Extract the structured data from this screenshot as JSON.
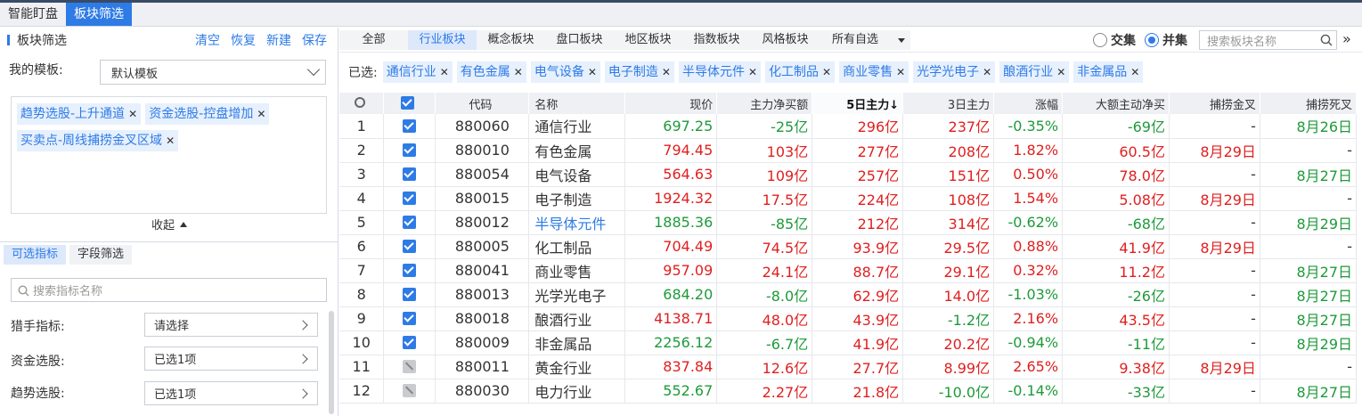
{
  "tabs": [
    "智能盯盘",
    "板块筛选"
  ],
  "left": {
    "title": "板块筛选",
    "actions": [
      "清空",
      "恢复",
      "新建",
      "保存"
    ],
    "template_label": "我的模板:",
    "template_value": "默认模板",
    "tags": [
      "趋势选股-上升通道",
      "资金选股-控盘增加",
      "买卖点-周线捕捞金叉区域"
    ],
    "collapse": "收起",
    "subtabs": [
      "可选指标",
      "字段筛选"
    ],
    "search_placeholder": "搜索指标名称",
    "filters": [
      {
        "label": "猎手指标:",
        "value": "请选择"
      },
      {
        "label": "资金选股:",
        "value": "已选1项"
      },
      {
        "label": "趋势选股:",
        "value": "已选1项"
      }
    ]
  },
  "right": {
    "category_tabs": [
      "全部",
      "行业板块",
      "概念板块",
      "盘口板块",
      "地区板块",
      "指数板块",
      "风格板块",
      "所有自选"
    ],
    "radio_intersect": "交集",
    "radio_union": "并集",
    "search_placeholder": "搜索板块名称",
    "selected_label": "已选:",
    "selected": [
      "通信行业",
      "有色金属",
      "电气设备",
      "电子制造",
      "半导体元件",
      "化工制品",
      "商业零售",
      "光学光电子",
      "酿酒行业",
      "非金属品"
    ],
    "columns": [
      "代码",
      "名称",
      "现价",
      "主力净买额",
      "5日主力↓",
      "3日主力",
      "涨幅",
      "大额主动净买",
      "捕捞金叉",
      "捕捞死叉"
    ],
    "rows": [
      {
        "n": "1",
        "checked": true,
        "code": "880060",
        "name": "通信行业",
        "price": "697.25",
        "main": "-25亿",
        "d5": "296亿",
        "d3": "237亿",
        "chg": "-0.35%",
        "big": "-69亿",
        "gold": "-",
        "dead": "8月26日"
      },
      {
        "n": "2",
        "checked": true,
        "code": "880010",
        "name": "有色金属",
        "price": "794.45",
        "main": "103亿",
        "d5": "277亿",
        "d3": "208亿",
        "chg": "1.82%",
        "big": "60.5亿",
        "gold": "8月29日",
        "dead": "-"
      },
      {
        "n": "3",
        "checked": true,
        "code": "880054",
        "name": "电气设备",
        "price": "564.63",
        "main": "109亿",
        "d5": "257亿",
        "d3": "151亿",
        "chg": "0.50%",
        "big": "78.0亿",
        "gold": "-",
        "dead": "8月27日"
      },
      {
        "n": "4",
        "checked": true,
        "code": "880015",
        "name": "电子制造",
        "price": "1924.32",
        "main": "17.5亿",
        "d5": "224亿",
        "d3": "108亿",
        "chg": "1.54%",
        "big": "5.08亿",
        "gold": "8月29日",
        "dead": "-"
      },
      {
        "n": "5",
        "checked": true,
        "code": "880012",
        "name": "半导体元件",
        "price": "1885.36",
        "main": "-85亿",
        "d5": "212亿",
        "d3": "314亿",
        "chg": "-0.62%",
        "big": "-68亿",
        "gold": "-",
        "dead": "8月29日"
      },
      {
        "n": "6",
        "checked": true,
        "code": "880005",
        "name": "化工制品",
        "price": "704.49",
        "main": "74.5亿",
        "d5": "93.9亿",
        "d3": "29.5亿",
        "chg": "0.88%",
        "big": "41.9亿",
        "gold": "8月29日",
        "dead": "-"
      },
      {
        "n": "7",
        "checked": true,
        "code": "880041",
        "name": "商业零售",
        "price": "957.09",
        "main": "24.1亿",
        "d5": "88.7亿",
        "d3": "29.1亿",
        "chg": "0.32%",
        "big": "11.2亿",
        "gold": "-",
        "dead": "8月27日"
      },
      {
        "n": "8",
        "checked": true,
        "code": "880013",
        "name": "光学光电子",
        "price": "684.20",
        "main": "-8.0亿",
        "d5": "62.9亿",
        "d3": "14.0亿",
        "chg": "-1.03%",
        "big": "-26亿",
        "gold": "-",
        "dead": "8月27日"
      },
      {
        "n": "9",
        "checked": true,
        "code": "880018",
        "name": "酿酒行业",
        "price": "4138.71",
        "main": "48.0亿",
        "d5": "43.9亿",
        "d3": "-1.2亿",
        "chg": "2.16%",
        "big": "43.5亿",
        "gold": "-",
        "dead": "8月27日"
      },
      {
        "n": "10",
        "checked": true,
        "code": "880009",
        "name": "非金属品",
        "price": "2256.12",
        "main": "-6.7亿",
        "d5": "41.9亿",
        "d3": "20.2亿",
        "chg": "-0.94%",
        "big": "-11亿",
        "gold": "-",
        "dead": "8月29日"
      },
      {
        "n": "11",
        "checked": false,
        "code": "880011",
        "name": "黄金行业",
        "price": "837.84",
        "main": "12.6亿",
        "d5": "27.7亿",
        "d3": "8.99亿",
        "chg": "2.65%",
        "big": "9.38亿",
        "gold": "8月29日",
        "dead": "-"
      },
      {
        "n": "12",
        "checked": false,
        "code": "880030",
        "name": "电力行业",
        "price": "552.67",
        "main": "2.27亿",
        "d5": "21.8亿",
        "d3": "-10.0亿",
        "chg": "-0.14%",
        "big": "-33亿",
        "gold": "-",
        "dead": "8月27日"
      }
    ]
  },
  "colors": {
    "accent": "#2e7be6",
    "up": "#e01f1f",
    "down": "#1e9a3a"
  }
}
